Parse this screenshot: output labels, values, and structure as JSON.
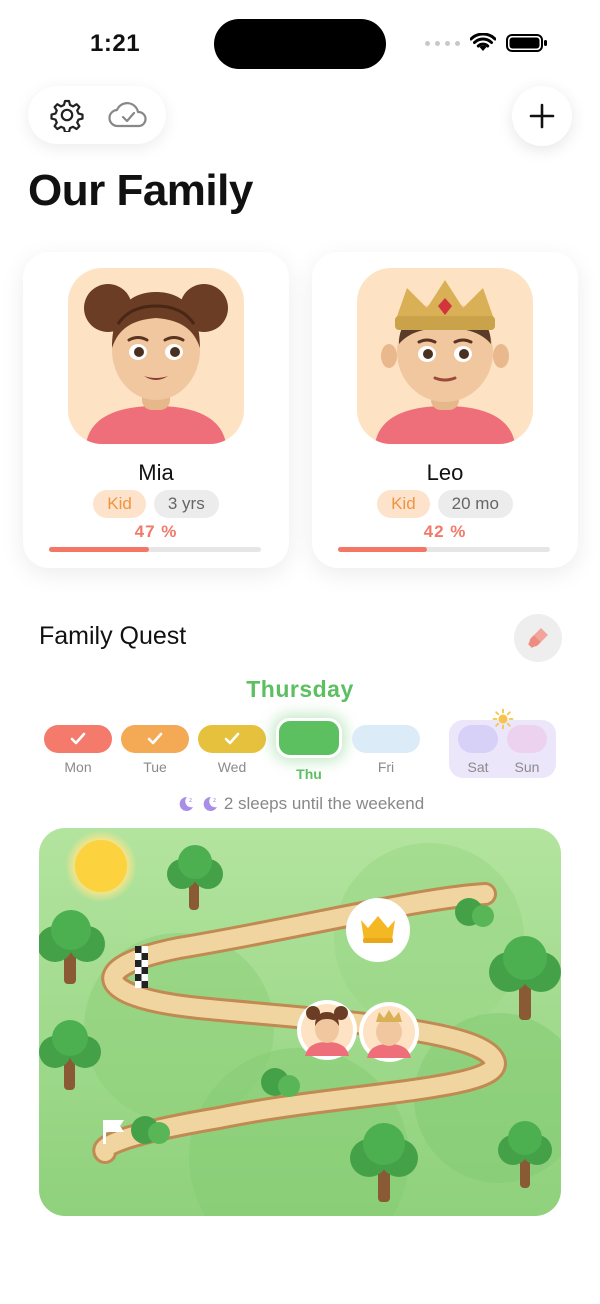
{
  "status_bar": {
    "time": "1:21"
  },
  "header": {
    "title": "Our Family"
  },
  "profiles": [
    {
      "name": "Mia",
      "tag": "Kid",
      "age": "3 yrs",
      "progress_label": "47 %",
      "progress": 0.47
    },
    {
      "name": "Leo",
      "tag": "Kid",
      "age": "20 mo",
      "progress_label": "42 %",
      "progress": 0.42
    }
  ],
  "quest": {
    "title": "Family Quest",
    "current_day": "Thursday",
    "days": [
      {
        "label": "Mon",
        "state": "done",
        "color": "#f47a6c"
      },
      {
        "label": "Tue",
        "state": "done",
        "color": "#f4a955"
      },
      {
        "label": "Wed",
        "state": "done",
        "color": "#e6c13e"
      },
      {
        "label": "Thu",
        "state": "current",
        "color": "#5cbf60"
      },
      {
        "label": "Fri",
        "state": "upcoming",
        "color": "#dcebf8"
      },
      {
        "label": "Sat",
        "state": "weekend",
        "color": "#d7d0f7"
      },
      {
        "label": "Sun",
        "state": "weekend",
        "color": "#ecd2ee"
      }
    ],
    "sleeps_text": "2 sleeps until the weekend"
  },
  "icons": [
    "gear-icon",
    "cloud-check-icon",
    "plus-icon",
    "paintbrush-icon",
    "checkmark-icon",
    "moon-icon",
    "sun-icon",
    "crown-icon",
    "checkered-flag-icon",
    "start-flag-icon"
  ],
  "colors": {
    "accent_green": "#5cbf60",
    "progress_red": "#f47766",
    "kid_tag": "#f0943f",
    "map_green": "#9fdc8b"
  }
}
